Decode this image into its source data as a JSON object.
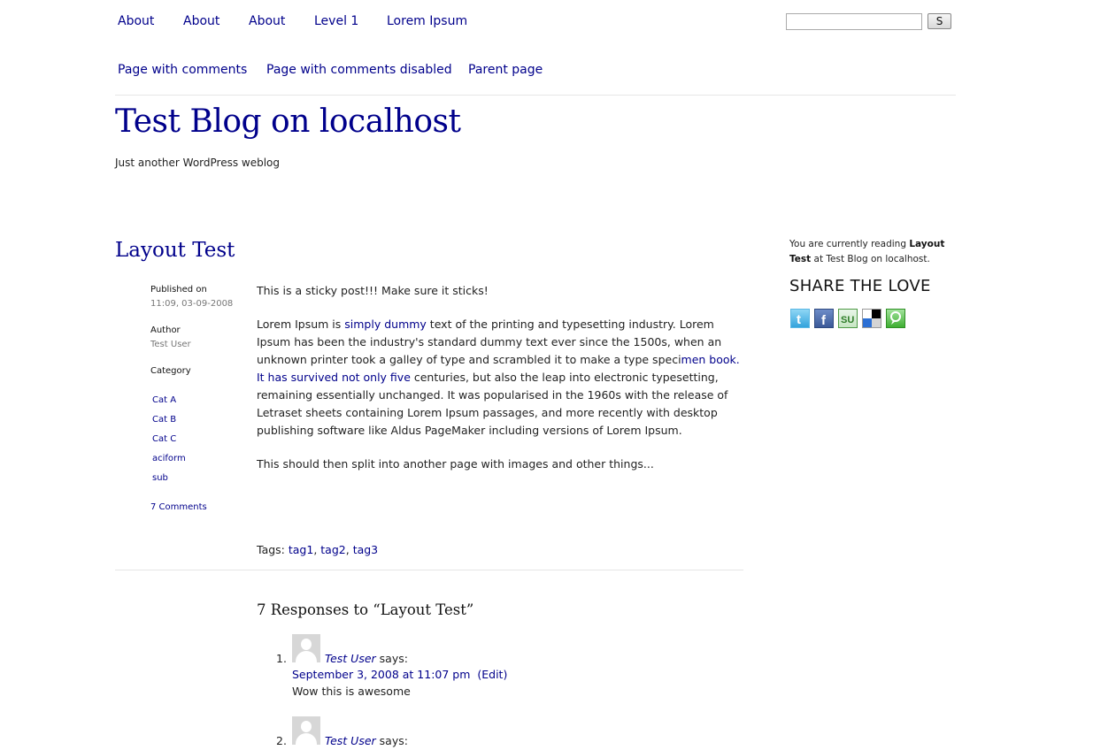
{
  "nav_top": [
    "About",
    "About",
    "About",
    "Level 1",
    "Lorem Ipsum"
  ],
  "nav_bottom": [
    "Page with comments",
    "Page with comments disabled",
    "Parent page"
  ],
  "search": {
    "value": "",
    "button_label": "S"
  },
  "site": {
    "title": "Test Blog on localhost",
    "tagline": "Just another WordPress weblog"
  },
  "post": {
    "title": "Layout Test",
    "published_label": "Published on",
    "published_value": "11:09, 03-09-2008",
    "author_label": "Author",
    "author_value": "Test User",
    "category_label": "Category",
    "categories": [
      "Cat A",
      "Cat B",
      "Cat C",
      "aciform",
      "sub"
    ],
    "comments_link": "7 Comments",
    "sticky_text": "This is a sticky post!!! Make sure it sticks!",
    "body": {
      "p1": "Lorem Ipsum is ",
      "link1": "simply dummy",
      "p2": " text of the printing and typesetting industry. Lorem Ipsum has been the industry's standard dummy text ever since the 1500s, when an unknown printer took a galley of type and scrambled it to make a type speci",
      "link2": "men book. It has survived not only five",
      "p3": " centuries, but also the leap into electronic typesetting, remaining essentially unchanged. It was popularised in the 1960s with the release of Letraset sheets containing Lorem Ipsum passages, and more recently with desktop publishing software like Aldus PageMaker including versions of Lorem Ipsum."
    },
    "split_text": "This should then split into another page with images and other things...",
    "tags_label": "Tags:",
    "tags": [
      "tag1",
      "tag2",
      "tag3"
    ]
  },
  "sidebar": {
    "reading_prefix": "You are currently reading",
    "reading_title": "Layout Test",
    "reading_suffix": "at Test Blog on localhost.",
    "share_title": "SHARE THE LOVE",
    "share_icons": [
      "twitter-icon",
      "facebook-icon",
      "stumbleupon-icon",
      "delicious-icon",
      "technorati-icon"
    ]
  },
  "responses": {
    "title": "7 Responses to “Layout Test”",
    "comments": [
      {
        "num": "1.",
        "author": "Test User",
        "says": "says:",
        "date": "September 3, 2008 at 11:07 pm",
        "edit": "(Edit)",
        "text": "Wow this is awesome"
      },
      {
        "num": "2.",
        "author": "Test User",
        "says": "says:"
      }
    ]
  }
}
